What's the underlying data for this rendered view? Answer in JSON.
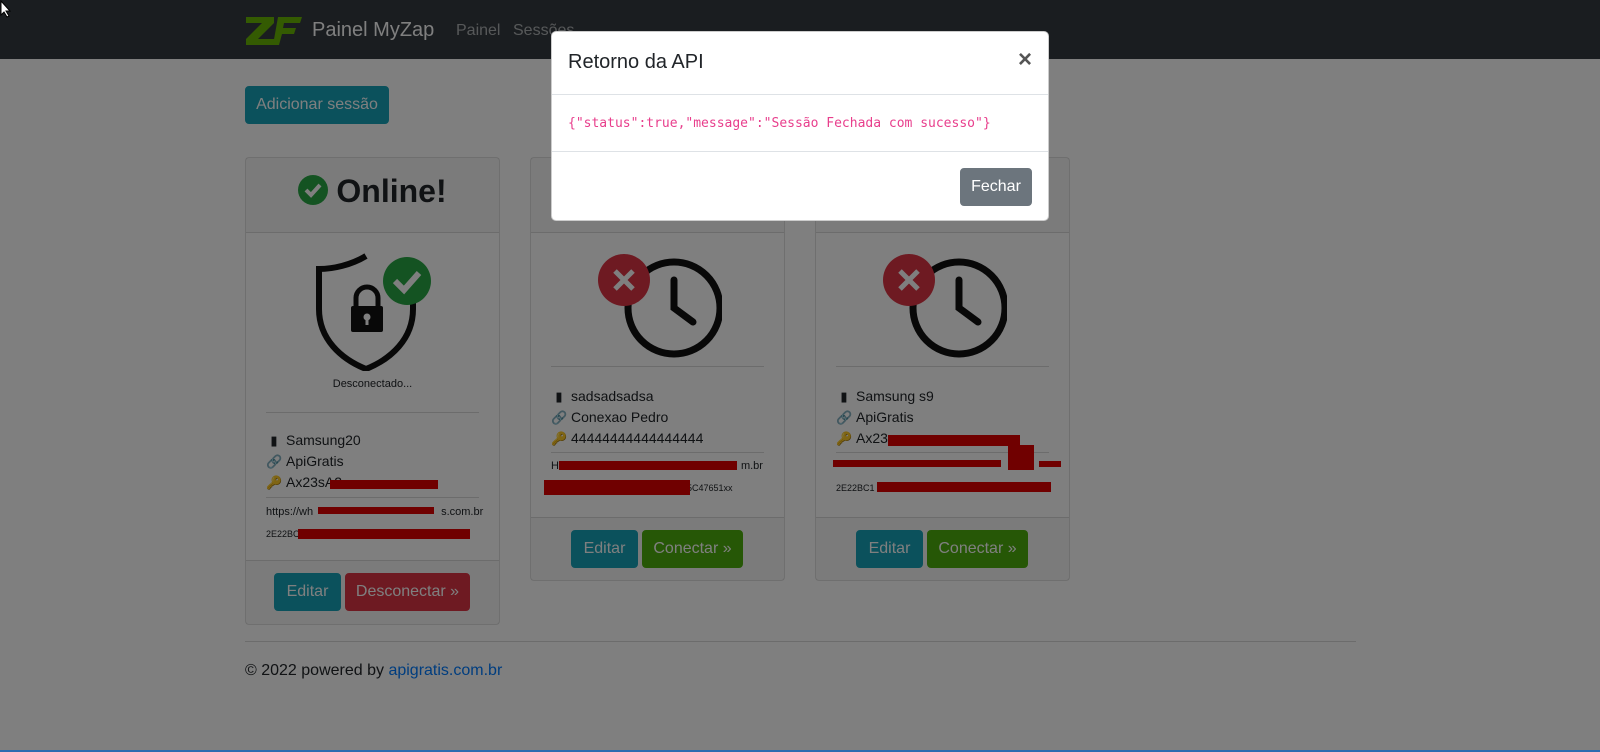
{
  "navbar": {
    "brand": "Painel MyZap",
    "links": [
      "Painel",
      "Sessões"
    ]
  },
  "actions": {
    "add_session": "Adicionar sessão"
  },
  "cards": [
    {
      "header": "Online!",
      "status_text": "Desconectado...",
      "device": "Samsung20",
      "connection": "ApiGratis",
      "key": "Ax23sA2",
      "url": "https://wh",
      "url_tail": "s.com.br",
      "token": "2E22BC",
      "buttons": {
        "edit": "Editar",
        "action": "Desconectar »"
      }
    },
    {
      "device": "sadsadsadsa",
      "connection": "Conexao Pedro",
      "key": "44444444444444444",
      "url_tail": "m.br",
      "token_tail": "5C47651xx",
      "buttons": {
        "edit": "Editar",
        "action": "Conectar »"
      }
    },
    {
      "device": "Samsung s9",
      "connection": "ApiGratis",
      "key": "Ax23",
      "token": "2E22BC1",
      "buttons": {
        "edit": "Editar",
        "action": "Conectar »"
      }
    }
  ],
  "footer": {
    "text": "© 2022 powered by",
    "link": "apigratis.com.br"
  },
  "modal": {
    "title": "Retorno da API",
    "close_icon": "×",
    "body": "{\"status\":true,\"message\":\"Sessão Fechada com sucesso\"}",
    "close_button": "Fechar"
  },
  "colors": {
    "navbar": "#343a40",
    "info": "#17a2b8",
    "success": "#28a745",
    "danger": "#dc3545",
    "secondary": "#6c757d",
    "code": "#e83e8c"
  }
}
